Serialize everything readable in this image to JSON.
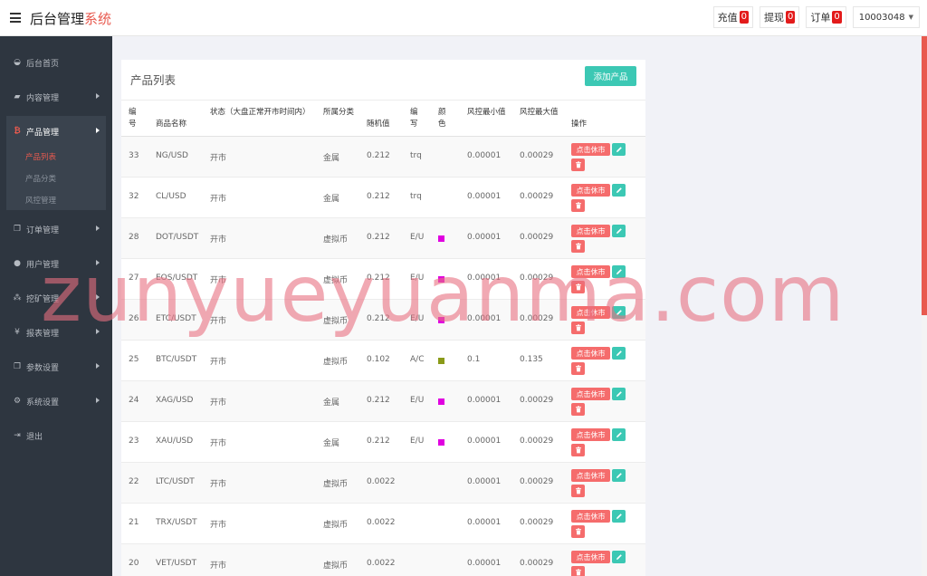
{
  "header": {
    "title_main": "后台管理",
    "title_accent": "系统",
    "recharge_label": "充值",
    "recharge_count": "0",
    "withdraw_label": "提现",
    "withdraw_count": "0",
    "orders_label": "订单",
    "orders_count": "0",
    "user_id": "10003048"
  },
  "sidebar": {
    "items": [
      {
        "label": "后台首页",
        "icon": "dashboard-icon"
      },
      {
        "label": "内容管理",
        "icon": "book-icon"
      },
      {
        "label": "产品管理",
        "icon": "bitcoin-icon"
      },
      {
        "label": "订单管理",
        "icon": "copy-icon"
      },
      {
        "label": "用户管理",
        "icon": "user-icon"
      },
      {
        "label": "挖矿管理",
        "icon": "sitemap-icon"
      },
      {
        "label": "报表管理",
        "icon": "yen-icon"
      },
      {
        "label": "参数设置",
        "icon": "copy-icon"
      },
      {
        "label": "系统设置",
        "icon": "gears-icon"
      },
      {
        "label": "退出",
        "icon": "sign-out-icon"
      }
    ],
    "sub_items": [
      "产品列表",
      "产品分类",
      "风控管理"
    ]
  },
  "panel": {
    "title": "产品列表",
    "add_button": "添加产品"
  },
  "table": {
    "headers": [
      "编号",
      "商品名称",
      "状态（大盘正常开市时间内）",
      "所属分类",
      "随机值",
      "编写",
      "颜色",
      "风控最小值",
      "风控最大值",
      "操作"
    ],
    "close_label": "点击休市",
    "rows": [
      {
        "id": "33",
        "name": "NG/USD",
        "status": "开市",
        "category": "金属",
        "random": "0.212",
        "code": "trq",
        "color": "",
        "min": "0.00001",
        "max": "0.00029"
      },
      {
        "id": "32",
        "name": "CL/USD",
        "status": "开市",
        "category": "金属",
        "random": "0.212",
        "code": "trq",
        "color": "",
        "min": "0.00001",
        "max": "0.00029"
      },
      {
        "id": "28",
        "name": "DOT/USDT",
        "status": "开市",
        "category": "虚拟币",
        "random": "0.212",
        "code": "E/U",
        "color": "#e000e0",
        "min": "0.00001",
        "max": "0.00029"
      },
      {
        "id": "27",
        "name": "EOS/USDT",
        "status": "开市",
        "category": "虚拟币",
        "random": "0.212",
        "code": "E/U",
        "color": "#e000e0",
        "min": "0.00001",
        "max": "0.00029"
      },
      {
        "id": "26",
        "name": "ETC/USDT",
        "status": "开市",
        "category": "虚拟币",
        "random": "0.212",
        "code": "E/U",
        "color": "#e000e0",
        "min": "0.00001",
        "max": "0.00029"
      },
      {
        "id": "25",
        "name": "BTC/USDT",
        "status": "开市",
        "category": "虚拟币",
        "random": "0.102",
        "code": "A/C",
        "color": "#8a9a18",
        "min": "0.1",
        "max": "0.135"
      },
      {
        "id": "24",
        "name": "XAG/USD",
        "status": "开市",
        "category": "金属",
        "random": "0.212",
        "code": "E/U",
        "color": "#e000e0",
        "min": "0.00001",
        "max": "0.00029"
      },
      {
        "id": "23",
        "name": "XAU/USD",
        "status": "开市",
        "category": "金属",
        "random": "0.212",
        "code": "E/U",
        "color": "#e000e0",
        "min": "0.00001",
        "max": "0.00029"
      },
      {
        "id": "22",
        "name": "LTC/USDT",
        "status": "开市",
        "category": "虚拟币",
        "random": "0.0022",
        "code": "",
        "color": "",
        "min": "0.00001",
        "max": "0.00029"
      },
      {
        "id": "21",
        "name": "TRX/USDT",
        "status": "开市",
        "category": "虚拟币",
        "random": "0.0022",
        "code": "",
        "color": "",
        "min": "0.00001",
        "max": "0.00029"
      },
      {
        "id": "20",
        "name": "VET/USDT",
        "status": "开市",
        "category": "虚拟币",
        "random": "0.0022",
        "code": "",
        "color": "",
        "min": "0.00001",
        "max": "0.00029"
      }
    ]
  },
  "watermark": "zunyueyuanma.com",
  "colors": {
    "accent": "#e85a4f",
    "teal": "#3cc8b4",
    "sidebar_bg": "#2e3640",
    "danger": "#f56c6c",
    "badge": "#e31b1b"
  }
}
